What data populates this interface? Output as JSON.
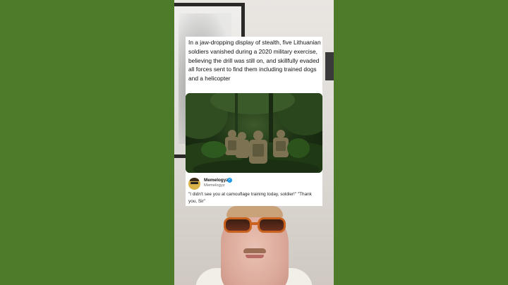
{
  "video": {
    "caption": "In a jaw-dropping display of stealth, five Lithuanian soldiers vanished during a 2020 military exercise, believing the drill was still on, and skillfully evaded all forces sent to find them including trained dogs and a helicopter",
    "tweet": {
      "name": "Memelogyz",
      "handle": "Memelogyz",
      "text": "\"I didn't see you at camouflage training today, soldier!\" \"Thank you, Sir\""
    }
  },
  "colors": {
    "background_green": "#4e7b29",
    "card_white": "#ffffff",
    "verified_blue": "#1d9bf0"
  }
}
